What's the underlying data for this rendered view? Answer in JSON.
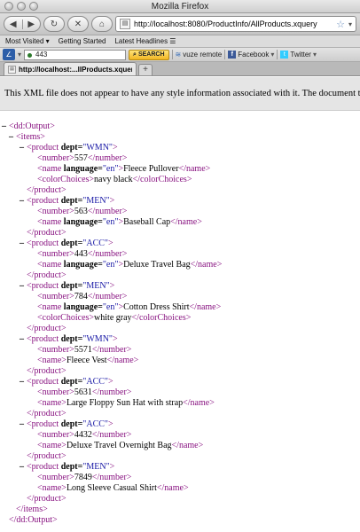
{
  "window": {
    "title": "Mozilla Firefox"
  },
  "toolbar": {
    "back_icon": "back-arrow-icon",
    "forward_icon": "forward-arrow-icon",
    "reload_icon": "reload-icon",
    "stop_icon": "stop-icon",
    "home_icon": "home-icon",
    "url": "http://localhost:8080/ProductInfo/AllProducts.xquery"
  },
  "bookmarks": {
    "items": [
      "Most Visited ▾",
      "Getting Started",
      "Latest Headlines ☰"
    ]
  },
  "addonbar": {
    "input_value": "443",
    "search_label": "SEARCH",
    "vuze_label": "vuze remote",
    "facebook_label": "Facebook",
    "twitter_label": "Twitter"
  },
  "tabs": [
    {
      "label": "http://localhost:...llProducts.xquery"
    }
  ],
  "page": {
    "info_banner": "This XML file does not appear to have any style information associated with it. The document tree is shown below."
  },
  "xml": {
    "root_open": "<dd:Output>",
    "root_close": "</dd:Output>",
    "items_open": "<items>",
    "items_close": "</items>",
    "products": [
      {
        "dept": "\"WMN\"",
        "number": "557",
        "name": "Fleece Pullover",
        "name_lang": "\"en\"",
        "colorChoices": "navy black"
      },
      {
        "dept": "\"MEN\"",
        "number": "563",
        "name": "Baseball Cap",
        "name_lang": "\"en\"",
        "colorChoices": null
      },
      {
        "dept": "\"ACC\"",
        "number": "443",
        "name": "Deluxe Travel Bag",
        "name_lang": "\"en\"",
        "colorChoices": null
      },
      {
        "dept": "\"MEN\"",
        "number": "784",
        "name": "Cotton Dress Shirt",
        "name_lang": "\"en\"",
        "colorChoices": "white gray"
      },
      {
        "dept": "\"WMN\"",
        "number": "5571",
        "name": "Fleece Vest",
        "name_lang": null,
        "colorChoices": null
      },
      {
        "dept": "\"ACC\"",
        "number": "5631",
        "name": "Large Floppy Sun Hat with strap",
        "name_lang": null,
        "colorChoices": null
      },
      {
        "dept": "\"ACC\"",
        "number": "4432",
        "name": "Deluxe Travel Overnight Bag",
        "name_lang": null,
        "colorChoices": null
      },
      {
        "dept": "\"MEN\"",
        "number": "7849",
        "name": "Long Sleeve Casual Shirt",
        "name_lang": null,
        "colorChoices": null
      }
    ]
  },
  "colors": {
    "tag": "#881280",
    "attr_value": "#1a1aa6",
    "banner_bg": "#e5e5e5"
  }
}
